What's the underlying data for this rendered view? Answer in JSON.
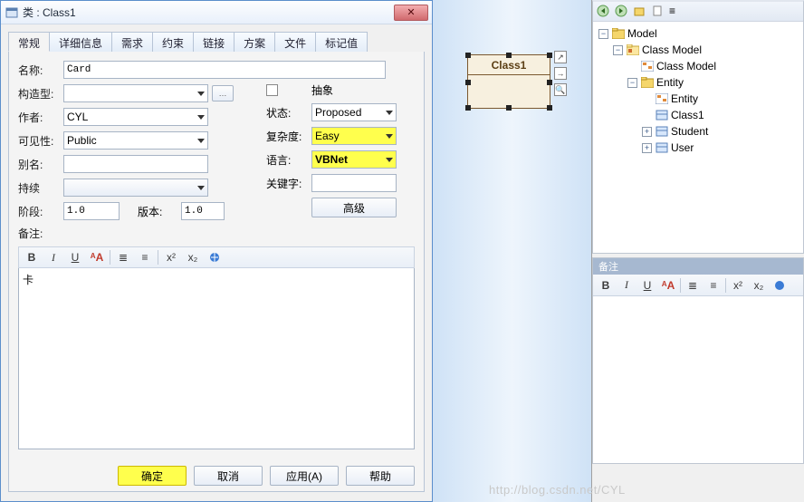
{
  "dialog": {
    "title": "类 : Class1",
    "tabs": [
      "常规",
      "详细信息",
      "需求",
      "约束",
      "链接",
      "方案",
      "文件",
      "标记值"
    ],
    "active_tab": 0,
    "labels": {
      "name": "名称:",
      "stereotype": "构造型:",
      "author": "作者:",
      "visibility": "可见性:",
      "alias": "别名:",
      "persist": "持续",
      "phase": "阶段:",
      "version": "版本:",
      "remark": "备注:",
      "abstract": "抽象",
      "status": "状态:",
      "complexity": "复杂度:",
      "language": "语言:",
      "keywords": "关键字:",
      "advanced": "高级"
    },
    "fields": {
      "name": "Card",
      "stereotype": "",
      "author": "CYL",
      "visibility": "Public",
      "alias": "",
      "persist": "",
      "phase": "1.0",
      "version": "1.0",
      "abstract_checked": false,
      "status": "Proposed",
      "complexity": "Easy",
      "language": "VBNet",
      "keywords": ""
    },
    "editor_text": "卡",
    "buttons": {
      "ok": "确定",
      "cancel": "取消",
      "apply": "应用(A)",
      "help": "帮助"
    }
  },
  "canvas": {
    "class_name": "Class1"
  },
  "tree": {
    "root": {
      "label": "Model",
      "icon": "pkg-root"
    },
    "nodes": [
      {
        "level": 2,
        "tog": "-",
        "icon": "pkg",
        "label": "Class Model"
      },
      {
        "level": 3,
        "tog": "",
        "icon": "diagram",
        "label": "Class Model"
      },
      {
        "level": 3,
        "tog": "-",
        "icon": "folder",
        "label": "Entity"
      },
      {
        "level": 4,
        "tog": "",
        "icon": "diagram",
        "label": "Entity"
      },
      {
        "level": 4,
        "tog": "",
        "icon": "class",
        "label": "Class1"
      },
      {
        "level": 4,
        "tog": "+",
        "icon": "class",
        "label": "Student"
      },
      {
        "level": 4,
        "tog": "+",
        "icon": "class",
        "label": "User"
      }
    ]
  },
  "remark_panel": {
    "title": "备注"
  },
  "watermark": "http://blog.csdn.net/CYL"
}
